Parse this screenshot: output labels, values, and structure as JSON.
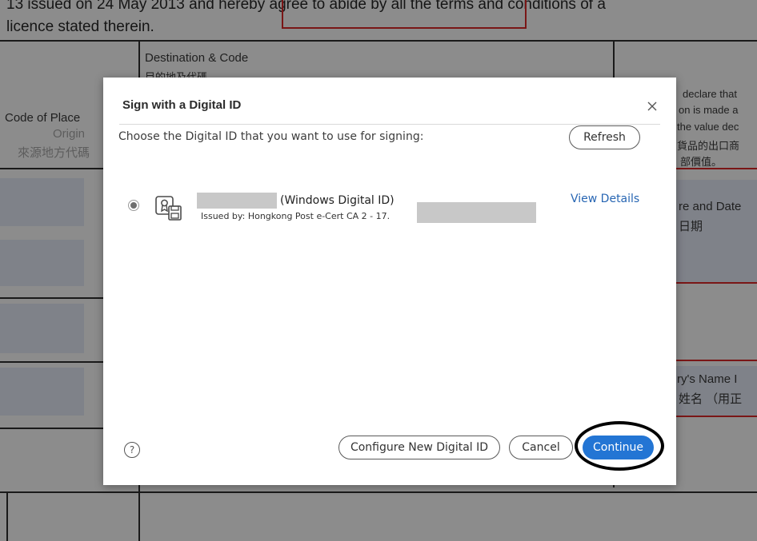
{
  "background_document": {
    "top_line_1": "13 issued on 24 May 2013 and hereby agree to abide by all the terms and conditions of a",
    "top_line_2": "licence stated therein.",
    "destination_header": "Destination & Code",
    "destination_header_cn": "目的地及代碼",
    "code_of_place": "Code of Place",
    "origin": "Origin",
    "origin_cn": "來源地方代碼",
    "right_declare_1": "declare that",
    "right_declare_2": "on is made a",
    "right_declare_3": "the value dec",
    "right_declare_cn_1": "貨品的出口商",
    "right_declare_cn_2": "部價值。",
    "signature_date": "re and Date",
    "signature_date_cn": "日期",
    "signatory_name": "ry's Name I",
    "signatory_name_cn": "姓名 （用正"
  },
  "dialog": {
    "title": "Sign with a Digital ID",
    "close_icon": "close-icon",
    "prompt": "Choose the Digital ID that you want to use for signing:",
    "refresh_label": "Refresh",
    "digital_id": {
      "selected": true,
      "icon": "certificate-icon",
      "type_label": "(Windows Digital ID)",
      "issuer_label": "Issued by: Hongkong Post e-Cert CA 2 - 17."
    },
    "view_details_label": "View Details",
    "help_icon": "help-icon",
    "configure_label": "Configure New Digital ID",
    "cancel_label": "Cancel",
    "continue_label": "Continue"
  },
  "colors": {
    "accent": "#2375d4",
    "link": "#2866b3",
    "annotation": "#000000"
  }
}
